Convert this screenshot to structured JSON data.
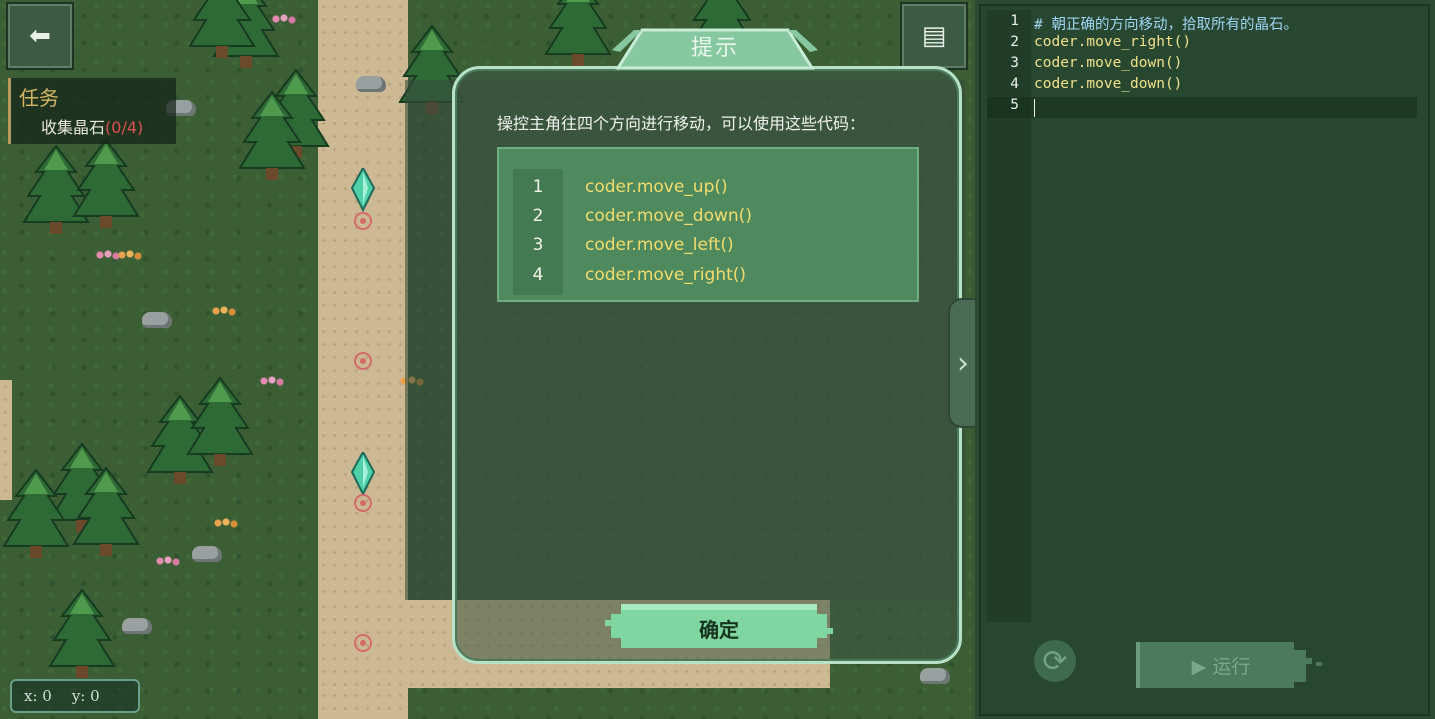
{
  "game": {
    "task_title": "任务",
    "task_item": "收集晶石",
    "task_count": "(0/4)",
    "coord_x": "x: 0",
    "coord_y": "y: 0",
    "back_icon": "arrow-left-icon",
    "doc_icon": "document-icon",
    "help_icon": "question-icon"
  },
  "hint_modal": {
    "title": "提示",
    "description": "操控主角往四个方向进行移动，可以使用这些代码：",
    "code_lines": [
      {
        "num": "1",
        "text": "coder.move_up()"
      },
      {
        "num": "2",
        "text": "coder.move_down()"
      },
      {
        "num": "3",
        "text": "coder.move_left()"
      },
      {
        "num": "4",
        "text": "coder.move_right()"
      }
    ],
    "confirm_label": "确定"
  },
  "editor": {
    "lines": [
      {
        "num": "1",
        "text": "# 朝正确的方向移动，拾取所有的晶石。",
        "kind": "comment"
      },
      {
        "num": "2",
        "text": "coder.move_right()",
        "kind": "code"
      },
      {
        "num": "3",
        "text": "coder.move_down()",
        "kind": "code"
      },
      {
        "num": "4",
        "text": "coder.move_down()",
        "kind": "code"
      },
      {
        "num": "5",
        "text": "",
        "kind": "code"
      }
    ],
    "run_label": "▶ 运行",
    "refresh_icon": "refresh-icon"
  },
  "colors": {
    "comment": "#9fd4f5",
    "code": "#f1e08a",
    "task_count": "#e05050",
    "hint_code": "#f3dc6b"
  }
}
